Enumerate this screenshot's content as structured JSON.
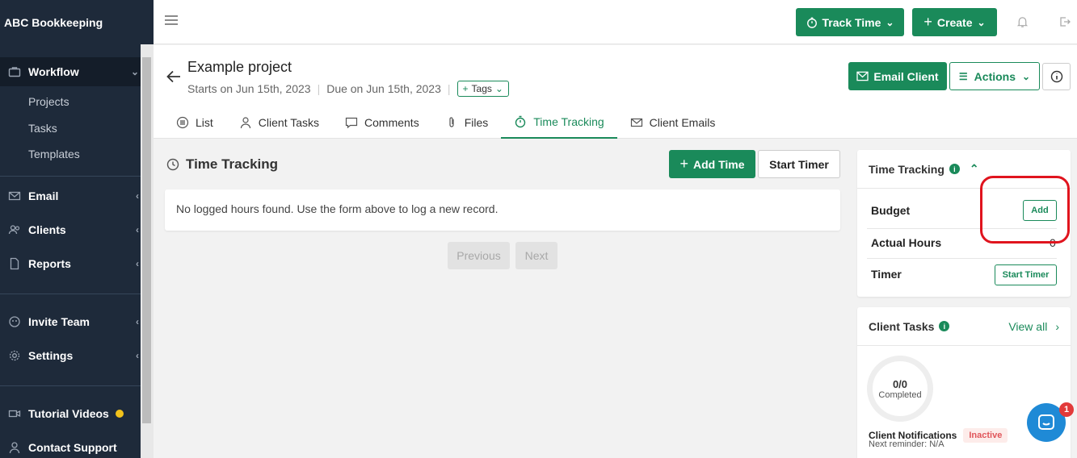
{
  "app": {
    "brand": "ABC Bookkeeping"
  },
  "sidebar": {
    "items": [
      {
        "label": "Workflow",
        "icon": "briefcase-icon"
      },
      {
        "label": "Email",
        "icon": "envelope-icon"
      },
      {
        "label": "Clients",
        "icon": "users-icon"
      },
      {
        "label": "Reports",
        "icon": "file-icon"
      },
      {
        "label": "Invite Team",
        "icon": "team-icon"
      },
      {
        "label": "Settings",
        "icon": "gear-icon"
      },
      {
        "label": "Tutorial Videos",
        "icon": "video-icon"
      },
      {
        "label": "Contact Support",
        "icon": "person-icon"
      }
    ],
    "workflow_sub": [
      "Projects",
      "Tasks",
      "Templates"
    ]
  },
  "topbar": {
    "track_time": "Track Time",
    "create": "Create"
  },
  "project": {
    "title": "Example project",
    "starts": "Starts on Jun 15th, 2023",
    "due": "Due on Jun 15th, 2023",
    "tags_label": "Tags",
    "email_client": "Email Client",
    "actions": "Actions"
  },
  "tabs": [
    "List",
    "Client Tasks",
    "Comments",
    "Files",
    "Time Tracking",
    "Client Emails"
  ],
  "main": {
    "section_title": "Time Tracking",
    "add_time": "Add Time",
    "start_timer": "Start Timer",
    "empty_message": "No logged hours found. Use the form above to log a new record.",
    "previous": "Previous",
    "next": "Next"
  },
  "time_card": {
    "title": "Time Tracking",
    "budget_label": "Budget",
    "add_label": "Add",
    "actual_hours_label": "Actual Hours",
    "actual_hours_value": "0",
    "timer_label": "Timer",
    "start_timer": "Start Timer"
  },
  "tasks_card": {
    "title": "Client Tasks",
    "view_all": "View all",
    "progress_value": "0/0",
    "progress_label": "Completed",
    "notifications_label": "Client Notifications",
    "notifications_status": "Inactive",
    "next_reminder": "Next reminder: N/A"
  },
  "chat": {
    "badge": "1"
  },
  "colors": {
    "brand_green": "#1a8a5a",
    "sidebar_bg": "#1e2a3a",
    "highlight_red": "#e0141e"
  }
}
